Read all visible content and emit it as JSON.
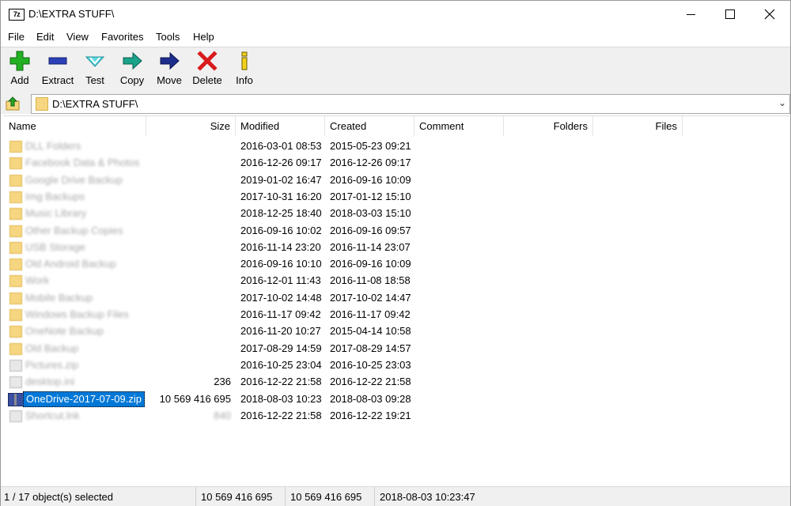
{
  "window": {
    "title": "D:\\EXTRA STUFF\\",
    "app_icon": "7z",
    "min_symbol": "—",
    "max_symbol": "□",
    "close_symbol": "✕"
  },
  "menu": [
    "File",
    "Edit",
    "View",
    "Favorites",
    "Tools",
    "Help"
  ],
  "toolbar": {
    "add": "Add",
    "extract": "Extract",
    "test": "Test",
    "copy": "Copy",
    "move": "Move",
    "delete": "Delete",
    "info": "Info"
  },
  "address": {
    "path": "D:\\EXTRA STUFF\\"
  },
  "columns": {
    "name": "Name",
    "size": "Size",
    "modified": "Modified",
    "created": "Created",
    "comment": "Comment",
    "folders": "Folders",
    "files": "Files"
  },
  "rows": [
    {
      "name": "DLL Folders",
      "size": "",
      "modified": "2016-03-01 08:53",
      "created": "2015-05-23 09:21"
    },
    {
      "name": "Facebook Data & Photos",
      "size": "",
      "modified": "2016-12-26 09:17",
      "created": "2016-12-26 09:17"
    },
    {
      "name": "Google Drive Backup",
      "size": "",
      "modified": "2019-01-02 16:47",
      "created": "2016-09-16 10:09"
    },
    {
      "name": "Img Backups",
      "size": "",
      "modified": "2017-10-31 16:20",
      "created": "2017-01-12 15:10"
    },
    {
      "name": "Music Library",
      "size": "",
      "modified": "2018-12-25 18:40",
      "created": "2018-03-03 15:10"
    },
    {
      "name": "Other Backup Copies",
      "size": "",
      "modified": "2016-09-16 10:02",
      "created": "2016-09-16 09:57"
    },
    {
      "name": "USB Storage",
      "size": "",
      "modified": "2016-11-14 23:20",
      "created": "2016-11-14 23:07"
    },
    {
      "name": "Old Android Backup",
      "size": "",
      "modified": "2016-09-16 10:10",
      "created": "2016-09-16 10:09"
    },
    {
      "name": "Work",
      "size": "",
      "modified": "2016-12-01 11:43",
      "created": "2016-11-08 18:58"
    },
    {
      "name": "Mobile Backup",
      "size": "",
      "modified": "2017-10-02 14:48",
      "created": "2017-10-02 14:47"
    },
    {
      "name": "Windows Backup Files",
      "size": "",
      "modified": "2016-11-17 09:42",
      "created": "2016-11-17 09:42"
    },
    {
      "name": "OneNote Backup",
      "size": "",
      "modified": "2016-11-20 10:27",
      "created": "2015-04-14 10:58"
    },
    {
      "name": "Old Backup",
      "size": "",
      "modified": "2017-08-29 14:59",
      "created": "2017-08-29 14:57"
    },
    {
      "name": "Pictures.zip",
      "size": "",
      "modified": "2016-10-25 23:04",
      "created": "2016-10-25 23:03"
    },
    {
      "name": "desktop.ini",
      "size": "236",
      "modified": "2016-12-22 21:58",
      "created": "2016-12-22 21:58"
    },
    {
      "name": "OneDrive-2017-07-09.zip",
      "size": "10 569 416 695",
      "modified": "2018-08-03 10:23",
      "created": "2018-08-03 09:28"
    },
    {
      "name": "Shortcut.lnk",
      "size": "840",
      "modified": "2016-12-22 21:58",
      "created": "2016-12-22 19:21"
    }
  ],
  "status": {
    "selected": "1 / 17 object(s) selected",
    "size": "10 569 416 695",
    "packed": "10 569 416 695",
    "date": "2018-08-03 10:23:47"
  },
  "colors": {
    "selection": "#0078d7",
    "folder": "#f6d680"
  }
}
